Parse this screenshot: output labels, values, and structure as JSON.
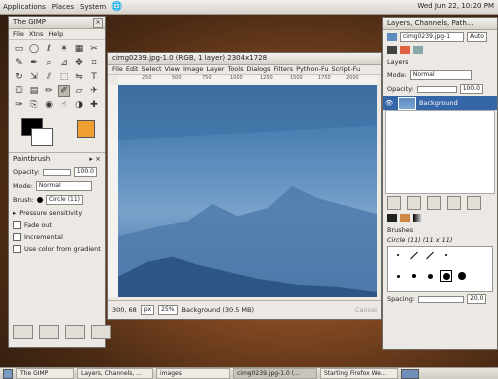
{
  "top_panel": {
    "menus": [
      "Applications",
      "Places",
      "System"
    ],
    "clock": "Wed Jun 22, 10:20 PM"
  },
  "toolbox": {
    "title": "The GIMP",
    "menu": [
      "File",
      "Xtns",
      "Help"
    ],
    "tool_icons": [
      "rect-select-icon",
      "ellipse-select-icon",
      "lasso-icon",
      "fuzzy-select-icon",
      "color-select-icon",
      "scissors-icon",
      "paths-icon",
      "color-picker-icon",
      "zoom-icon",
      "measure-icon",
      "move-icon",
      "crop-icon",
      "rotate-icon",
      "scale-icon",
      "shear-icon",
      "perspective-icon",
      "flip-icon",
      "text-icon",
      "bucket-icon",
      "blend-icon",
      "pencil-icon",
      "paintbrush-icon",
      "eraser-icon",
      "airbrush-icon",
      "ink-icon",
      "clone-icon",
      "convolve-icon",
      "smudge-icon",
      "dodge-icon",
      "heal-icon"
    ],
    "selected_tool_index": 21,
    "paintbrush": {
      "title": "Paintbrush",
      "opacity_label": "Opacity:",
      "opacity_value": "100.0",
      "mode_label": "Mode:",
      "mode_value": "Normal",
      "brush_label": "Brush:",
      "brush_value": "Circle (11)",
      "pressure": "Pressure sensitivity",
      "fade": "Fade out",
      "incremental": "Incremental",
      "gradient": "Use color from gradient"
    }
  },
  "image_window": {
    "title": "cimg0239.jpg-1.0 (RGB, 1 layer) 2304x1728",
    "menu": [
      "File",
      "Edit",
      "Select",
      "View",
      "Image",
      "Layer",
      "Tools",
      "Dialogs",
      "Filters",
      "Python-Fu",
      "Script-Fu"
    ],
    "ruler_marks": [
      "250",
      "500",
      "750",
      "1000",
      "1250",
      "1500",
      "1750",
      "2000"
    ],
    "coords": "300, 68",
    "unit": "px",
    "zoom": "25%",
    "status": "Background (30.5 MB)",
    "cancel": "Cancel"
  },
  "layers_dock": {
    "title": "Layers, Channels, Path...",
    "image_select": "cimg0239.jpg-1",
    "auto": "Auto",
    "section": "Layers",
    "mode_label": "Mode:",
    "mode_value": "Normal",
    "opacity_label": "Opacity:",
    "opacity_value": "100.0",
    "layer_name": "Background",
    "brushes_title": "Brushes",
    "brush_name": "Circle (11) (11 x 11)",
    "spacing_label": "Spacing:",
    "spacing_value": "20.0"
  },
  "taskbar": {
    "items": [
      "The GIMP",
      "Layers, Channels, ...",
      "images",
      "cimg0239.jpg-1.0 (...",
      "Starting Firefox We..."
    ]
  },
  "colors": {
    "desktop": "#8a4d24",
    "layer_highlight": "#3466a8"
  }
}
